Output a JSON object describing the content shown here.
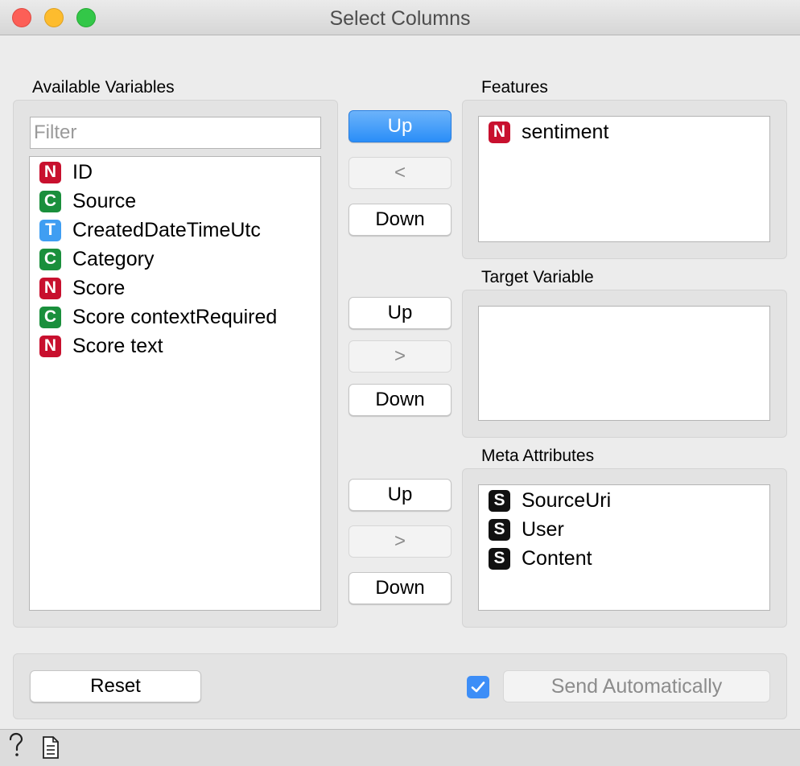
{
  "window": {
    "title": "Select Columns"
  },
  "available": {
    "label": "Available Variables",
    "filter_placeholder": "Filter",
    "items": [
      {
        "type": "N",
        "name": "ID"
      },
      {
        "type": "C",
        "name": "Source"
      },
      {
        "type": "T",
        "name": "CreatedDateTimeUtc"
      },
      {
        "type": "C",
        "name": "Category"
      },
      {
        "type": "N",
        "name": "Score"
      },
      {
        "type": "C",
        "name": "Score contextRequired"
      },
      {
        "type": "N",
        "name": "Score text"
      }
    ]
  },
  "features": {
    "label": "Features",
    "items": [
      {
        "type": "N",
        "name": "sentiment"
      }
    ],
    "buttons": {
      "up": "Up",
      "move": "<",
      "down": "Down"
    }
  },
  "target": {
    "label": "Target Variable",
    "items": [],
    "buttons": {
      "up": "Up",
      "move": ">",
      "down": "Down"
    }
  },
  "meta": {
    "label": "Meta Attributes",
    "items": [
      {
        "type": "S",
        "name": "SourceUri"
      },
      {
        "type": "S",
        "name": "User"
      },
      {
        "type": "S",
        "name": "Content"
      }
    ],
    "buttons": {
      "up": "Up",
      "move": ">",
      "down": "Down"
    }
  },
  "footer": {
    "reset_label": "Reset",
    "send_automatically_checked": true,
    "send_automatically_label": "Send Automatically"
  },
  "badge_colors": {
    "N": "#c8102e",
    "C": "#1a8f3c",
    "T": "#3f9ef2",
    "S": "#111111"
  },
  "status_icons": [
    "help-icon",
    "report-icon"
  ]
}
